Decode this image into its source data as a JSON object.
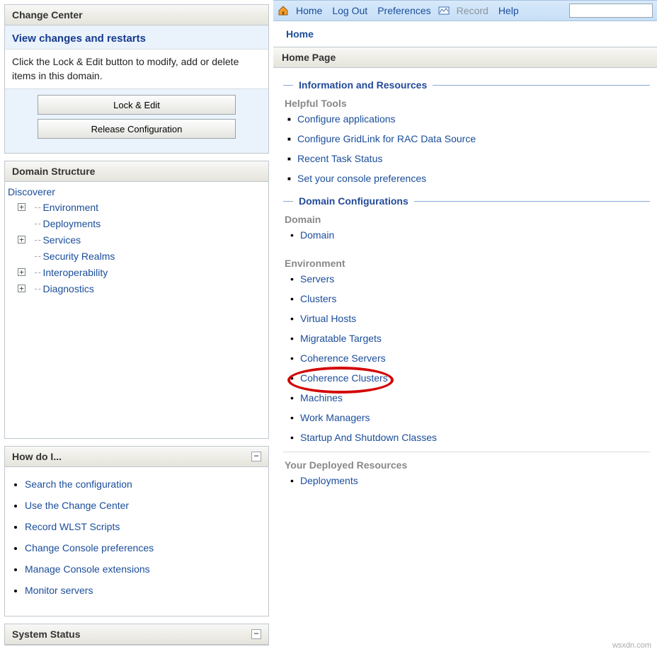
{
  "change_center": {
    "title": "Change Center",
    "view_link": "View changes and restarts",
    "hint": "Click the Lock & Edit button to modify, add or delete items in this domain.",
    "lock_btn": "Lock & Edit",
    "release_btn": "Release Configuration"
  },
  "domain_structure": {
    "title": "Domain Structure",
    "root": "Discoverer",
    "items": [
      {
        "label": "Environment",
        "expandable": true
      },
      {
        "label": "Deployments",
        "expandable": false
      },
      {
        "label": "Services",
        "expandable": true
      },
      {
        "label": "Security Realms",
        "expandable": false
      },
      {
        "label": "Interoperability",
        "expandable": true
      },
      {
        "label": "Diagnostics",
        "expandable": true
      }
    ]
  },
  "howdoi": {
    "title": "How do I...",
    "items": [
      "Search the configuration",
      "Use the Change Center",
      "Record WLST Scripts",
      "Change Console preferences",
      "Manage Console extensions",
      "Monitor servers"
    ]
  },
  "system_status": {
    "title": "System Status"
  },
  "topbar": {
    "home": "Home",
    "logout": "Log Out",
    "prefs": "Preferences",
    "record": "Record",
    "help": "Help",
    "search_ph": ""
  },
  "breadcrumb": "Home",
  "page_title": "Home Page",
  "info_section": {
    "title": "Information and Resources",
    "helpful": "Helpful Tools",
    "links": [
      "Configure applications",
      "Configure GridLink for RAC Data Source",
      "Recent Task Status",
      "Set your console preferences"
    ]
  },
  "domain_config": {
    "title": "Domain Configurations",
    "domain_h": "Domain",
    "domain_links": [
      "Domain"
    ],
    "env_h": "Environment",
    "env_links": [
      "Servers",
      "Clusters",
      "Virtual Hosts",
      "Migratable Targets",
      "Coherence Servers",
      "Coherence Clusters",
      "Machines",
      "Work Managers",
      "Startup And Shutdown Classes"
    ],
    "deployed_h": "Your Deployed Resources",
    "deployed_links": [
      "Deployments"
    ]
  },
  "watermark": "wsxdn.com"
}
